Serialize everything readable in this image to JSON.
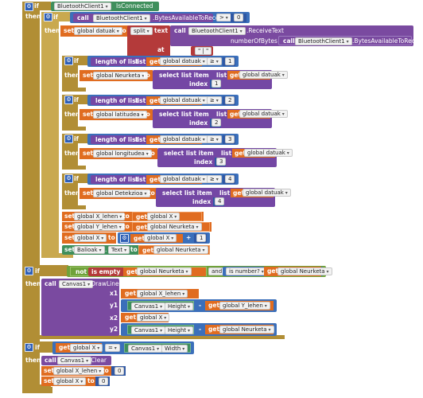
{
  "kw": {
    "if": "if",
    "then": "then",
    "call": "call",
    "set": "set",
    "to": "to",
    "get": "get",
    "split": "split",
    "text": "text",
    "at": "at",
    "length_of_list": "length of list",
    "list": "list",
    "select_list_item": "select list item",
    "index": "index",
    "not": "not",
    "is_empty": "is empty",
    "and": "and",
    "is_number": "is number?",
    "x1": "x1",
    "y1": "y1",
    "x2": "x2",
    "y2": "y2",
    "numberOfBytes": "numberOfBytes"
  },
  "components": {
    "bt": "BluetoothClient1",
    "canvas": "Canvas1",
    "balioak": "Balioak"
  },
  "methods": {
    "isConnected": "IsConnected",
    "bytesAvail": ".BytesAvailableToReceive",
    "receiveText": ".ReceiveText",
    "drawLine": ".DrawLine",
    "clear": ".Clear",
    "height": "Height",
    "width": "Width",
    "text_prop": "Text"
  },
  "vars": {
    "datuak": "global datuak",
    "neurketa": "global Neurketa",
    "latitudea": "global latitudea",
    "longitudea": "global longitudea",
    "detekzioa": "global Detekzioa",
    "x_lehen": "global X_lehen",
    "y_lehen": "global Y_lehen",
    "x": "global X"
  },
  "ops": {
    "gt": ">",
    "eq": "=",
    "minus": "-",
    "plus": "+",
    "ge": "≥"
  },
  "literals": {
    "zero": "0",
    "one": "1",
    "two": "2",
    "three": "3",
    "four": "4",
    "sep": "\" | \""
  },
  "colors": {
    "control": "#b18e35",
    "component": "#3f8f5c",
    "compare": "#3b6fba",
    "variable": "#e06c20",
    "text": "#b43a3a",
    "list": "#7447a4",
    "logic": "#6fa23a"
  }
}
